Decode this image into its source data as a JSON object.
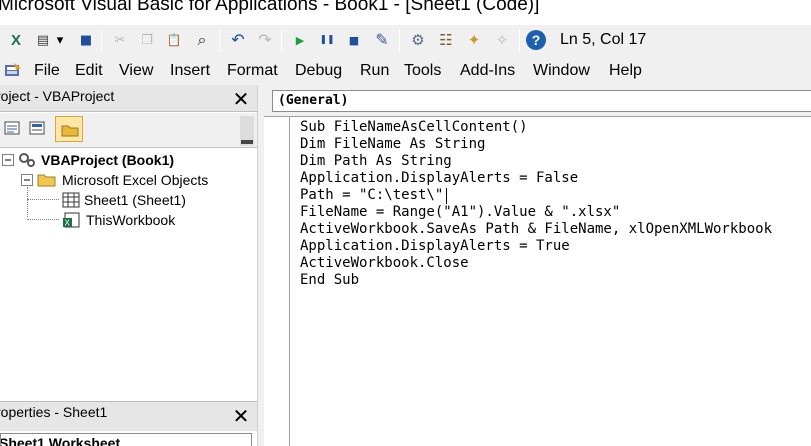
{
  "window": {
    "title": "Microsoft Visual Basic for Applications - Book1 - [Sheet1 (Code)]"
  },
  "toolbar": {
    "buttons": [
      {
        "icon": "excel-view-icon",
        "glyph": "X",
        "color": "#1d7044"
      },
      {
        "icon": "insert-userform-icon",
        "glyph": "▤",
        "color": "#3c3c3c"
      },
      {
        "icon": "dropdown-arrow-icon",
        "glyph": "▾",
        "color": "#000000"
      },
      {
        "icon": "save-icon",
        "glyph": "■",
        "color": "#1f4e9a"
      },
      {
        "icon": "cut-icon",
        "glyph": "✂",
        "color": "#b8b8b8"
      },
      {
        "icon": "copy-icon",
        "glyph": "❐",
        "color": "#b8b8b8"
      },
      {
        "icon": "paste-icon",
        "glyph": "📋",
        "color": "#8a6d2b"
      },
      {
        "icon": "find-icon",
        "glyph": "⌕",
        "color": "#2c2c2c"
      },
      {
        "icon": "undo-icon",
        "glyph": "↶",
        "color": "#1f4e9a"
      },
      {
        "icon": "redo-icon",
        "glyph": "↷",
        "color": "#b8b8b8"
      },
      {
        "icon": "run-icon",
        "glyph": "▶",
        "color": "#1e9e3e"
      },
      {
        "icon": "break-icon",
        "glyph": "❚❚",
        "color": "#1f4e9a"
      },
      {
        "icon": "reset-icon",
        "glyph": "■",
        "color": "#1f4e9a"
      },
      {
        "icon": "design-mode-icon",
        "glyph": "✎",
        "color": "#3a5aa0"
      },
      {
        "icon": "project-explorer-icon",
        "glyph": "⚙",
        "color": "#5a6a8a"
      },
      {
        "icon": "properties-window-icon",
        "glyph": "☷",
        "color": "#7a5a2a"
      },
      {
        "icon": "object-browser-icon",
        "glyph": "✦",
        "color": "#c89a20"
      },
      {
        "icon": "toolbox-icon",
        "glyph": "✧",
        "color": "#b8b8b8"
      },
      {
        "icon": "help-icon",
        "glyph": "?",
        "color": "#1f5fb0"
      }
    ],
    "status": "Ln 5, Col 17"
  },
  "menu": {
    "items": [
      {
        "label": "File"
      },
      {
        "label": "Edit"
      },
      {
        "label": "View"
      },
      {
        "label": "Insert"
      },
      {
        "label": "Format"
      },
      {
        "label": "Debug"
      },
      {
        "label": "Run"
      },
      {
        "label": "Tools"
      },
      {
        "label": "Add-Ins"
      },
      {
        "label": "Window"
      },
      {
        "label": "Help"
      }
    ]
  },
  "project_panel": {
    "title": "roject - VBAProject",
    "close_label": "✕",
    "tree": [
      {
        "label": "VBAProject (Book1)",
        "icon": "vbaproject-icon"
      },
      {
        "label": "Microsoft Excel Objects",
        "icon": "folder-icon"
      },
      {
        "label": "Sheet1 (Sheet1)",
        "icon": "worksheet-icon"
      },
      {
        "label": "ThisWorkbook",
        "icon": "workbook-icon"
      }
    ]
  },
  "properties_panel": {
    "title": "roperties - Sheet1",
    "close_label": "✕",
    "object_combo": "Sheet1 Worksheet"
  },
  "code_window": {
    "object_combo": "(General)",
    "lines": [
      "Sub FileNameAsCellContent()",
      "Dim FileName As String",
      "Dim Path As String",
      "Application.DisplayAlerts = False",
      "Path = \"C:\\test\\\"",
      "FileName = Range(\"A1\").Value & \".xlsx\"",
      "ActiveWorkbook.SaveAs Path & FileName, xlOpenXMLWorkbook",
      "Application.DisplayAlerts = True",
      "ActiveWorkbook.Close",
      "End Sub"
    ]
  },
  "colors": {
    "toolbar_bg": "#f0f0f0",
    "panel_header_bg": "#e6e6e6",
    "selected_item_bg": "#ffffff"
  }
}
